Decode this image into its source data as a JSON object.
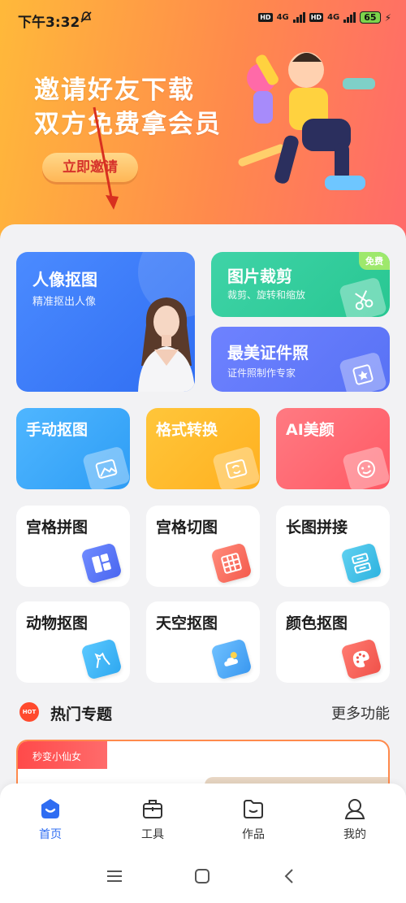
{
  "status": {
    "time": "下午3:32",
    "hd1": "HD",
    "net1": "4G",
    "hd2": "HD",
    "net2": "4G",
    "battery": "65"
  },
  "banner": {
    "line1": "邀请好友下载",
    "line2": "双方免费拿会员",
    "invite_button": "立即邀请"
  },
  "features": {
    "portrait": {
      "title": "人像抠图",
      "subtitle": "精准抠出人像"
    },
    "crop": {
      "title": "图片裁剪",
      "subtitle": "裁剪、旋转和缩放",
      "badge": "免费"
    },
    "idphoto": {
      "title": "最美证件照",
      "subtitle": "证件照制作专家"
    },
    "manual": {
      "title": "手动抠图"
    },
    "format": {
      "title": "格式转换"
    },
    "beauty": {
      "title": "AI美颜"
    },
    "grid_collage": {
      "title": "宫格拼图"
    },
    "grid_cut": {
      "title": "宫格切图"
    },
    "long_stitch": {
      "title": "长图拼接"
    },
    "animal": {
      "title": "动物抠图"
    },
    "sky": {
      "title": "天空抠图"
    },
    "color": {
      "title": "颜色抠图"
    }
  },
  "hot": {
    "icon_text": "HOT",
    "title": "热门专题",
    "more": "更多功能",
    "topic_tag": "秒变小仙女"
  },
  "nav": {
    "home": "首页",
    "tools": "工具",
    "works": "作品",
    "mine": "我的"
  },
  "colors": {
    "accent": "#2f6df2",
    "banner_start": "#ffb93a",
    "banner_end": "#ff6a6a"
  }
}
